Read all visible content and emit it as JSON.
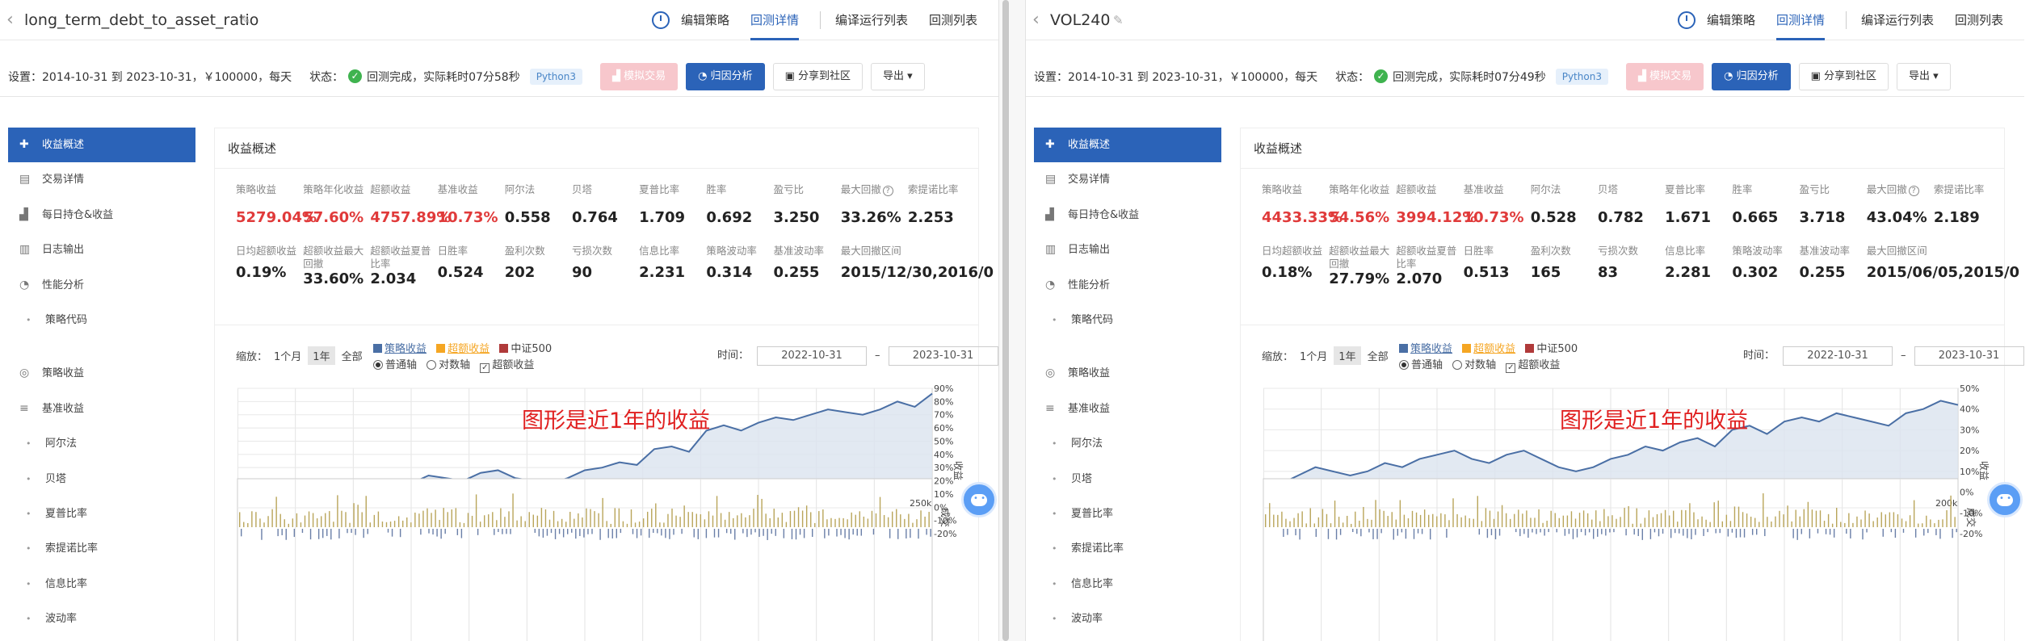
{
  "panes": [
    {
      "title": "long_term_debt_to_asset_ratio",
      "nav": [
        "编辑策略",
        "回测详情",
        "编译运行列表",
        "回测列表"
      ],
      "nav_active": 1,
      "settings": "设置：2014-10-31 到 2023-10-31，￥100000，每天",
      "status_label": "状态：",
      "status_text": "回测完成，实际耗时07分58秒",
      "python_tag": "Python3",
      "buttons": {
        "sim": "模拟交易",
        "attr": "归因分析",
        "share": "分享到社区",
        "export": "导出 ▾"
      },
      "sidebar": [
        {
          "label": "收益概述",
          "icon": "✚",
          "type": "main",
          "active": true
        },
        {
          "label": "交易详情",
          "icon": "▤",
          "type": "main"
        },
        {
          "label": "每日持仓&收益",
          "icon": "▟",
          "type": "main"
        },
        {
          "label": "日志输出",
          "icon": "▥",
          "type": "main"
        },
        {
          "label": "性能分析",
          "icon": "◔",
          "type": "main"
        },
        {
          "label": "策略代码",
          "icon": "•",
          "type": "sub"
        },
        {
          "label": "策略收益",
          "icon": "◎",
          "type": "main",
          "gap": true
        },
        {
          "label": "基准收益",
          "icon": "≡",
          "type": "main"
        },
        {
          "label": "阿尔法",
          "icon": "•",
          "type": "sub"
        },
        {
          "label": "贝塔",
          "icon": "•",
          "type": "sub"
        },
        {
          "label": "夏普比率",
          "icon": "•",
          "type": "sub"
        },
        {
          "label": "索提诺比率",
          "icon": "•",
          "type": "sub"
        },
        {
          "label": "信息比率",
          "icon": "•",
          "type": "sub"
        },
        {
          "label": "波动率",
          "icon": "•",
          "type": "sub"
        }
      ],
      "panel_title": "收益概述",
      "metrics_row1": [
        {
          "label": "策略收益",
          "value": "5279.04%",
          "red": true
        },
        {
          "label": "策略年化收益",
          "value": "57.60%",
          "red": true
        },
        {
          "label": "超额收益",
          "value": "4757.89%",
          "red": true
        },
        {
          "label": "基准收益",
          "value": "10.73%",
          "red": true
        },
        {
          "label": "阿尔法",
          "value": "0.558"
        },
        {
          "label": "贝塔",
          "value": "0.764"
        },
        {
          "label": "夏普比率",
          "value": "1.709"
        },
        {
          "label": "胜率",
          "value": "0.692"
        },
        {
          "label": "盈亏比",
          "value": "3.250"
        },
        {
          "label": "最大回撤",
          "value": "33.26%",
          "q": true
        },
        {
          "label": "索提诺比率",
          "value": "2.253"
        }
      ],
      "metrics_row2": [
        {
          "label": "日均超额收益",
          "value": "0.19%"
        },
        {
          "label": "超额收益最大回撤",
          "value": "33.60%"
        },
        {
          "label": "超额收益夏普比率",
          "value": "2.034"
        },
        {
          "label": "日胜率",
          "value": "0.524"
        },
        {
          "label": "盈利次数",
          "value": "202"
        },
        {
          "label": "亏损次数",
          "value": "90"
        },
        {
          "label": "信息比率",
          "value": "2.231"
        },
        {
          "label": "策略波动率",
          "value": "0.314"
        },
        {
          "label": "基准波动率",
          "value": "0.255"
        },
        {
          "label": "最大回撤区间",
          "value": "2015/12/30,2016/0"
        }
      ],
      "chart_controls": {
        "zoom_label": "缩放：",
        "zoom": [
          "1个月",
          "1年",
          "全部"
        ],
        "zoom_active": 1,
        "legend": [
          "策略收益",
          "超额收益",
          "中证500"
        ],
        "axis": [
          "普通轴",
          "对数轴"
        ],
        "excess_check": "超额收益",
        "time_label": "时间：",
        "date_from": "2022-10-31",
        "date_to": "2023-10-31"
      },
      "annotation": "图形是近1年的收益",
      "chart_data": {
        "type": "line",
        "y_ticks": [
          "90%",
          "80%",
          "70%",
          "60%",
          "50%",
          "40%",
          "30%",
          "20%",
          "10%",
          "0%",
          "-10%",
          "-20%"
        ],
        "ylim": [
          -20,
          90
        ],
        "ylabel": "收益",
        "series": [
          {
            "name": "策略收益",
            "color": "#4a6fa5",
            "values": [
              -2,
              2,
              6,
              10,
              8,
              4,
              6,
              10,
              12,
              16,
              18,
              24,
              22,
              20,
              26,
              28,
              22,
              20,
              18,
              22,
              28,
              30,
              34,
              32,
              44,
              46,
              42,
              58,
              62,
              58,
              64,
              68,
              66,
              70,
              74,
              72,
              70,
              74,
              80,
              76,
              86
            ]
          },
          {
            "name": "中证500",
            "color": "#b03a3a",
            "values": [
              0,
              2,
              4,
              6,
              4,
              2,
              3,
              5,
              6,
              6,
              5,
              5,
              6,
              4,
              3,
              4,
              5,
              4,
              3,
              4,
              3,
              2,
              2,
              3,
              2,
              4,
              3,
              2,
              2,
              1,
              1,
              2,
              1,
              0,
              0,
              -1,
              -2,
              -1,
              -2,
              -1,
              -3
            ]
          }
        ]
      },
      "volume_label": "成交",
      "volume_tick": "250k"
    },
    {
      "title": "VOL240",
      "nav": [
        "编辑策略",
        "回测详情",
        "编译运行列表",
        "回测列表"
      ],
      "nav_active": 1,
      "settings": "设置：2014-10-31 到 2023-10-31，￥100000，每天",
      "status_label": "状态：",
      "status_text": "回测完成，实际耗时07分49秒",
      "python_tag": "Python3",
      "buttons": {
        "sim": "模拟交易",
        "attr": "归因分析",
        "share": "分享到社区",
        "export": "导出 ▾"
      },
      "sidebar": [
        {
          "label": "收益概述",
          "icon": "✚",
          "type": "main",
          "active": true
        },
        {
          "label": "交易详情",
          "icon": "▤",
          "type": "main"
        },
        {
          "label": "每日持仓&收益",
          "icon": "▟",
          "type": "main"
        },
        {
          "label": "日志输出",
          "icon": "▥",
          "type": "main"
        },
        {
          "label": "性能分析",
          "icon": "◔",
          "type": "main"
        },
        {
          "label": "策略代码",
          "icon": "•",
          "type": "sub"
        },
        {
          "label": "策略收益",
          "icon": "◎",
          "type": "main",
          "gap": true
        },
        {
          "label": "基准收益",
          "icon": "≡",
          "type": "main"
        },
        {
          "label": "阿尔法",
          "icon": "•",
          "type": "sub"
        },
        {
          "label": "贝塔",
          "icon": "•",
          "type": "sub"
        },
        {
          "label": "夏普比率",
          "icon": "•",
          "type": "sub"
        },
        {
          "label": "索提诺比率",
          "icon": "•",
          "type": "sub"
        },
        {
          "label": "信息比率",
          "icon": "•",
          "type": "sub"
        },
        {
          "label": "波动率",
          "icon": "•",
          "type": "sub"
        }
      ],
      "panel_title": "收益概述",
      "metrics_row1": [
        {
          "label": "策略收益",
          "value": "4433.33%",
          "red": true
        },
        {
          "label": "策略年化收益",
          "value": "54.56%",
          "red": true
        },
        {
          "label": "超额收益",
          "value": "3994.12%",
          "red": true
        },
        {
          "label": "基准收益",
          "value": "10.73%",
          "red": true
        },
        {
          "label": "阿尔法",
          "value": "0.528"
        },
        {
          "label": "贝塔",
          "value": "0.782"
        },
        {
          "label": "夏普比率",
          "value": "1.671"
        },
        {
          "label": "胜率",
          "value": "0.665"
        },
        {
          "label": "盈亏比",
          "value": "3.718"
        },
        {
          "label": "最大回撤",
          "value": "43.04%",
          "q": true
        },
        {
          "label": "索提诺比率",
          "value": "2.189"
        }
      ],
      "metrics_row2": [
        {
          "label": "日均超额收益",
          "value": "0.18%"
        },
        {
          "label": "超额收益最大回撤",
          "value": "27.79%"
        },
        {
          "label": "超额收益夏普比率",
          "value": "2.070"
        },
        {
          "label": "日胜率",
          "value": "0.513"
        },
        {
          "label": "盈利次数",
          "value": "165"
        },
        {
          "label": "亏损次数",
          "value": "83"
        },
        {
          "label": "信息比率",
          "value": "2.281"
        },
        {
          "label": "策略波动率",
          "value": "0.302"
        },
        {
          "label": "基准波动率",
          "value": "0.255"
        },
        {
          "label": "最大回撤区间",
          "value": "2015/06/05,2015/0"
        }
      ],
      "chart_controls": {
        "zoom_label": "缩放：",
        "zoom": [
          "1个月",
          "1年",
          "全部"
        ],
        "zoom_active": 1,
        "legend": [
          "策略收益",
          "超额收益",
          "中证500"
        ],
        "axis": [
          "普通轴",
          "对数轴"
        ],
        "excess_check": "超额收益",
        "time_label": "时间：",
        "date_from": "2022-10-31",
        "date_to": "2023-10-31"
      },
      "annotation": "图形是近1年的收益",
      "chart_data": {
        "type": "line",
        "y_ticks": [
          "50%",
          "40%",
          "30%",
          "20%",
          "10%",
          "0%",
          "-10%",
          "-20%"
        ],
        "ylim": [
          -20,
          50
        ],
        "ylabel": "收益",
        "series": [
          {
            "name": "策略收益",
            "color": "#4a6fa5",
            "values": [
              0,
              4,
              8,
              12,
              10,
              8,
              10,
              14,
              12,
              16,
              18,
              20,
              16,
              14,
              18,
              20,
              16,
              12,
              10,
              12,
              16,
              18,
              22,
              20,
              24,
              26,
              22,
              30,
              32,
              28,
              34,
              36,
              34,
              38,
              36,
              34,
              32,
              38,
              40,
              44,
              42
            ]
          },
          {
            "name": "中证500",
            "color": "#b03a3a",
            "values": [
              1,
              2,
              4,
              6,
              4,
              2,
              3,
              5,
              6,
              6,
              5,
              5,
              6,
              4,
              3,
              4,
              5,
              4,
              3,
              4,
              3,
              2,
              2,
              3,
              2,
              4,
              3,
              2,
              2,
              1,
              1,
              2,
              1,
              0,
              0,
              -1,
              -2,
              -4,
              -6,
              -5,
              -7
            ]
          }
        ]
      },
      "volume_label": "成交",
      "volume_tick": "200k"
    }
  ]
}
